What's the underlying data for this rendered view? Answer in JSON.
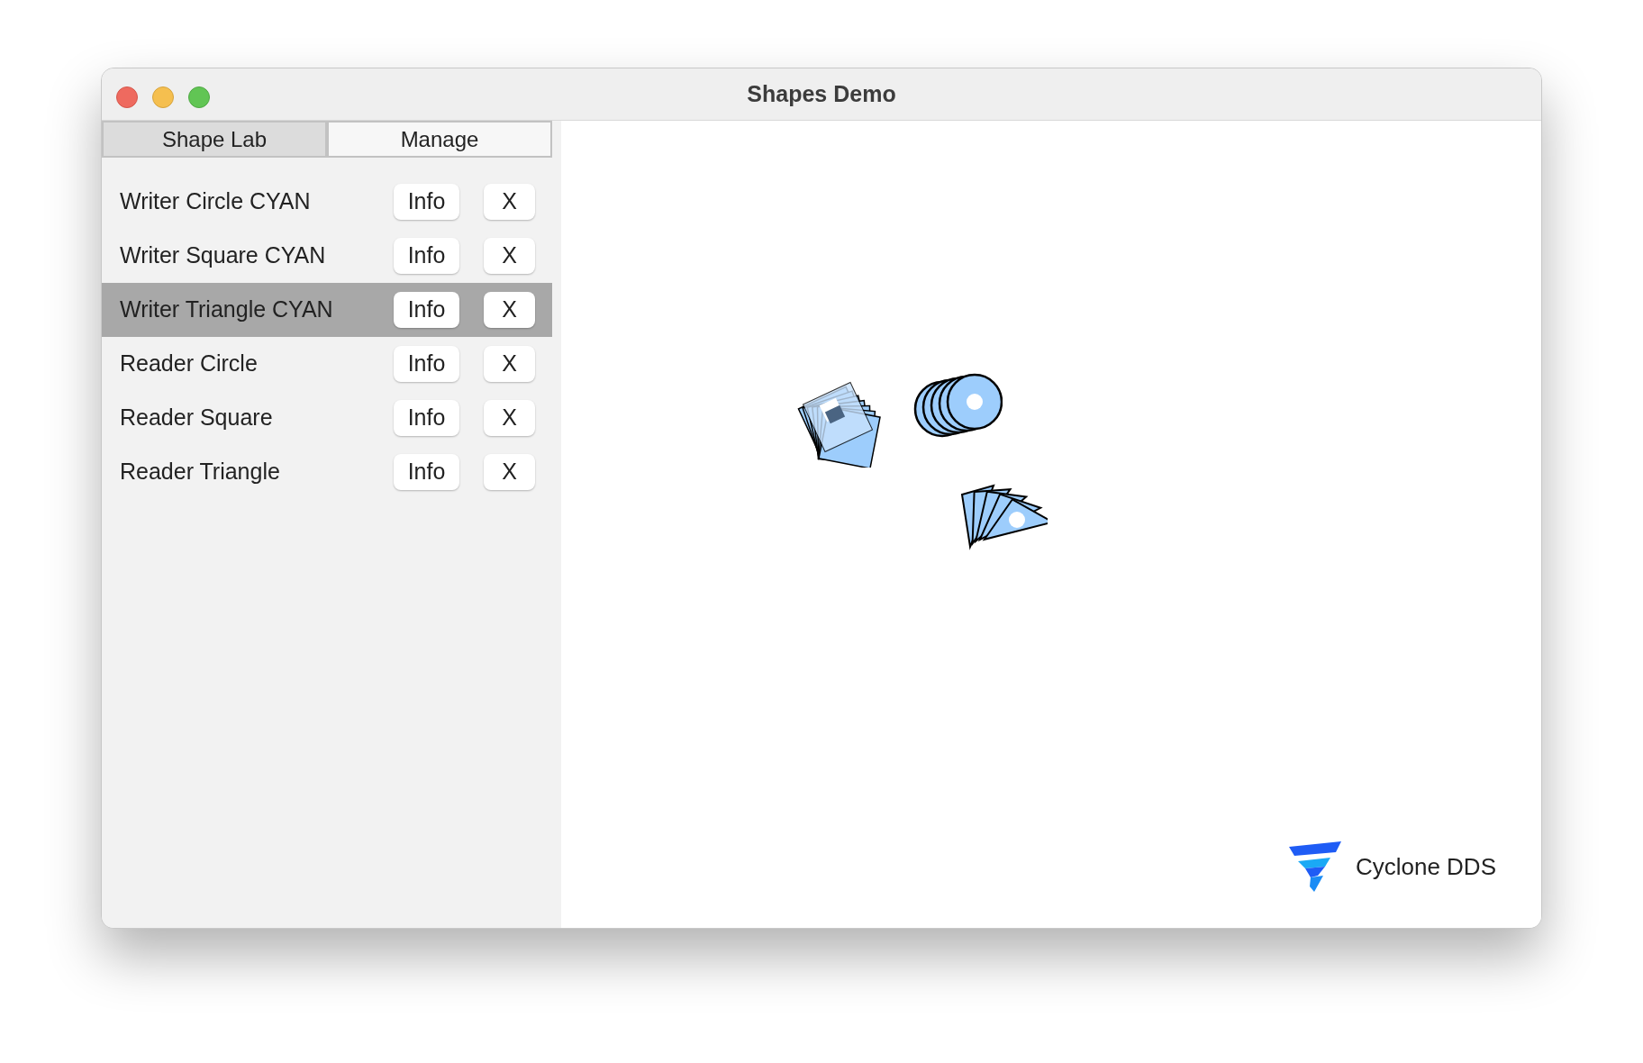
{
  "window": {
    "title": "Shapes Demo"
  },
  "tabs": [
    {
      "label": "Shape Lab",
      "selected": true
    },
    {
      "label": "Manage",
      "selected": false
    }
  ],
  "entities": [
    {
      "name": "Writer Circle CYAN",
      "selected": false,
      "info": "Info",
      "remove": "X"
    },
    {
      "name": "Writer Square CYAN",
      "selected": false,
      "info": "Info",
      "remove": "X"
    },
    {
      "name": "Writer Triangle CYAN",
      "selected": true,
      "info": "Info",
      "remove": "X"
    },
    {
      "name": "Reader Circle",
      "selected": false,
      "info": "Info",
      "remove": "X"
    },
    {
      "name": "Reader Square",
      "selected": false,
      "info": "Info",
      "remove": "X"
    },
    {
      "name": "Reader Triangle",
      "selected": false,
      "info": "Info",
      "remove": "X"
    }
  ],
  "logo": {
    "text": "Cyclone DDS"
  }
}
